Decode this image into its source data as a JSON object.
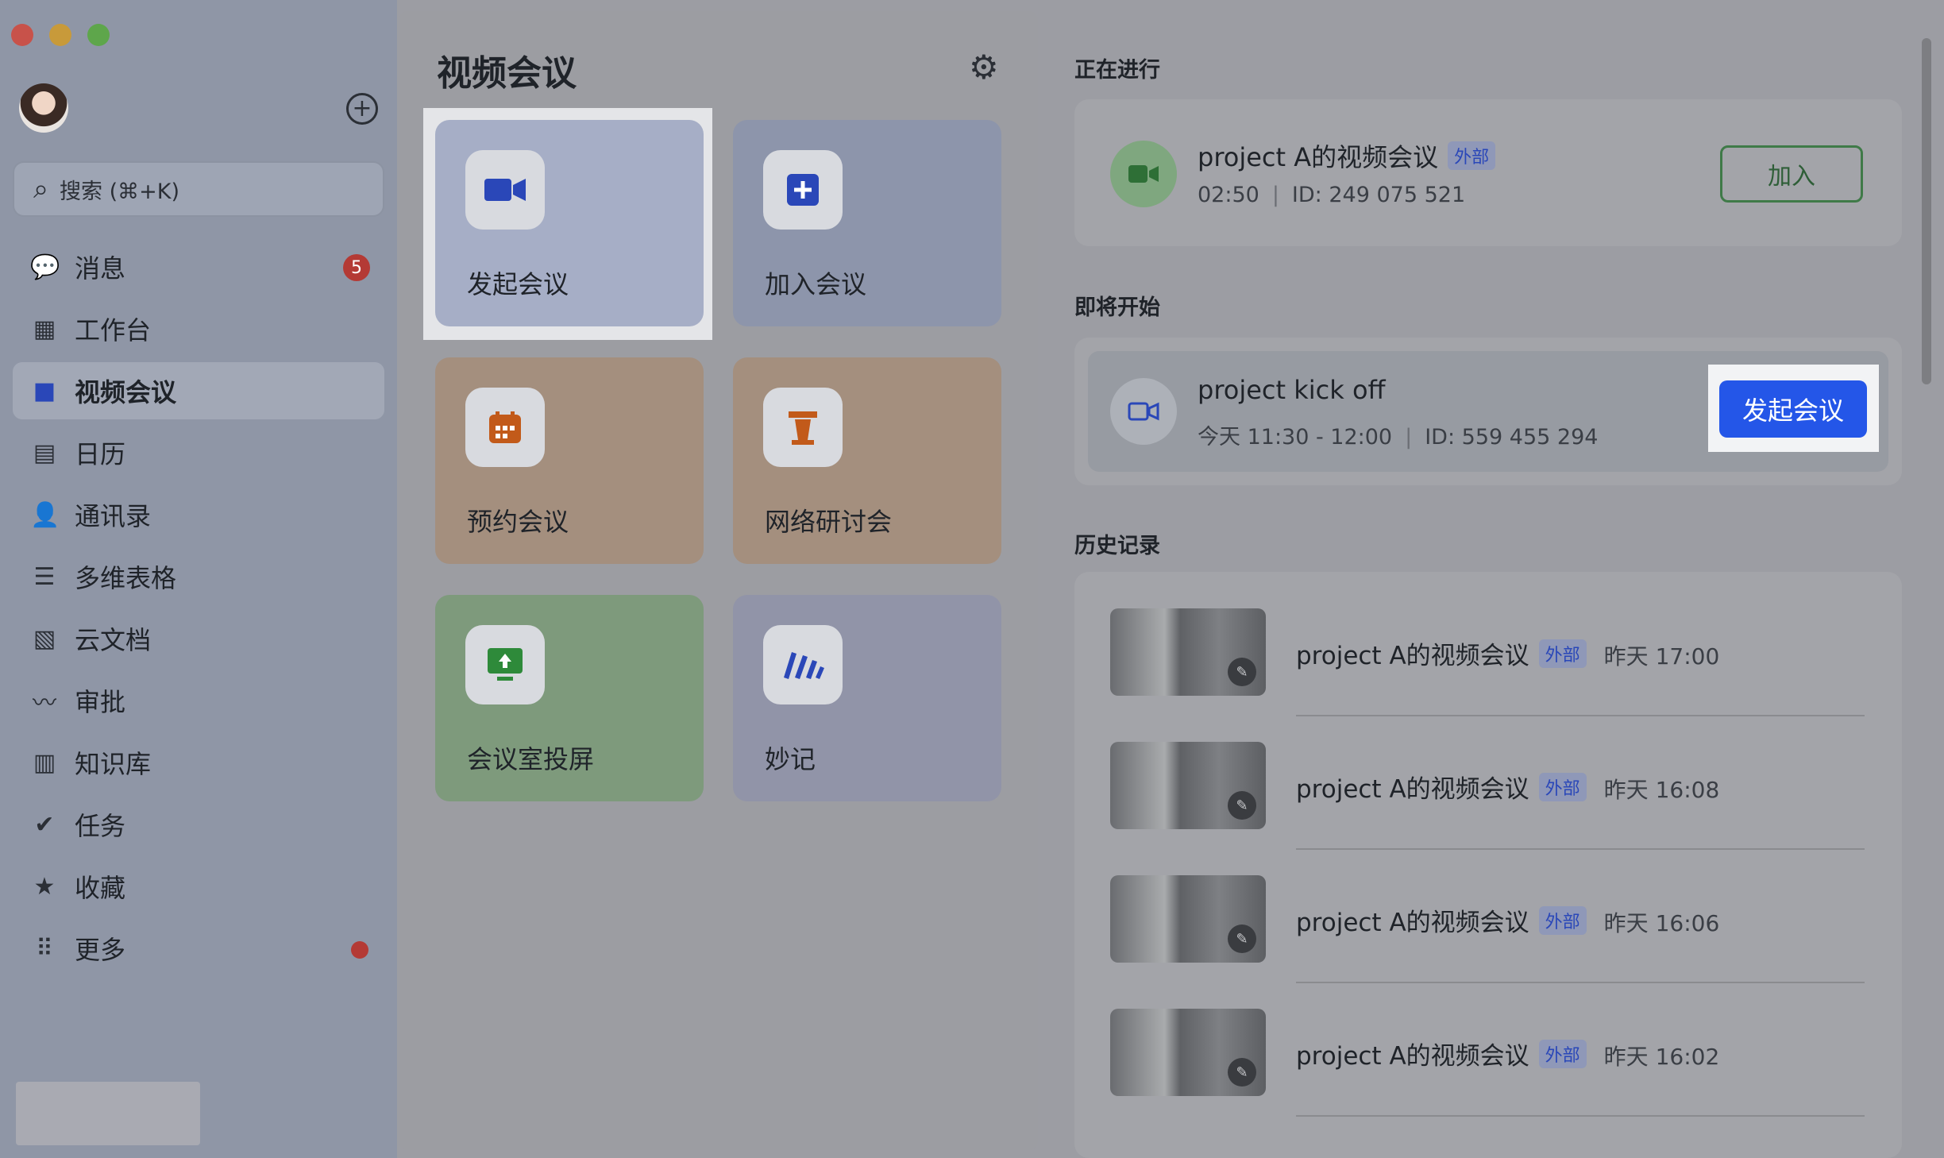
{
  "window": {
    "traffic_lights": [
      "close",
      "minimize",
      "zoom"
    ]
  },
  "sidebar": {
    "search_placeholder": "搜索 (⌘+K)",
    "items": [
      {
        "label": "消息",
        "icon": "message-icon",
        "badge": "5"
      },
      {
        "label": "工作台",
        "icon": "workspace-icon"
      },
      {
        "label": "视频会议",
        "icon": "video-camera-icon",
        "active": true
      },
      {
        "label": "日历",
        "icon": "calendar-icon"
      },
      {
        "label": "通讯录",
        "icon": "contacts-icon"
      },
      {
        "label": "多维表格",
        "icon": "base-table-icon"
      },
      {
        "label": "云文档",
        "icon": "cloud-doc-icon"
      },
      {
        "label": "审批",
        "icon": "approval-icon"
      },
      {
        "label": "知识库",
        "icon": "wiki-icon"
      },
      {
        "label": "任务",
        "icon": "task-icon"
      },
      {
        "label": "收藏",
        "icon": "star-icon"
      },
      {
        "label": "更多",
        "icon": "more-grid-icon",
        "dot": true
      }
    ]
  },
  "middle": {
    "title": "视频会议",
    "tiles": [
      {
        "label": "发起会议",
        "icon": "video-camera-icon",
        "color": "#2a47b8"
      },
      {
        "label": "加入会议",
        "icon": "plus-square-icon",
        "color": "#2a47b8"
      },
      {
        "label": "预约会议",
        "icon": "calendar-grid-icon",
        "color": "#c25a1a"
      },
      {
        "label": "网络研讨会",
        "icon": "podium-icon",
        "color": "#c25a1a"
      },
      {
        "label": "会议室投屏",
        "icon": "screen-share-icon",
        "color": "#2e8a3a"
      },
      {
        "label": "妙记",
        "icon": "minutes-icon",
        "color": "#2a47b8"
      }
    ]
  },
  "right": {
    "ongoing": {
      "section": "正在进行",
      "title": "project A的视频会议",
      "tag": "外部",
      "duration": "02:50",
      "meeting_id": "ID: 249 075 521",
      "join_label": "加入"
    },
    "upcoming": {
      "section": "即将开始",
      "title": "project kick off",
      "time": "今天 11:30 - 12:00",
      "meeting_id": "ID: 559 455 294",
      "start_label": "发起会议"
    },
    "history": {
      "section": "历史记录",
      "items": [
        {
          "title": "project A的视频会议",
          "tag": "外部",
          "time": "昨天 17:00"
        },
        {
          "title": "project A的视频会议",
          "tag": "外部",
          "time": "昨天 16:08"
        },
        {
          "title": "project A的视频会议",
          "tag": "外部",
          "time": "昨天 16:06"
        },
        {
          "title": "project A的视频会议",
          "tag": "外部",
          "time": "昨天 16:02"
        }
      ]
    }
  }
}
